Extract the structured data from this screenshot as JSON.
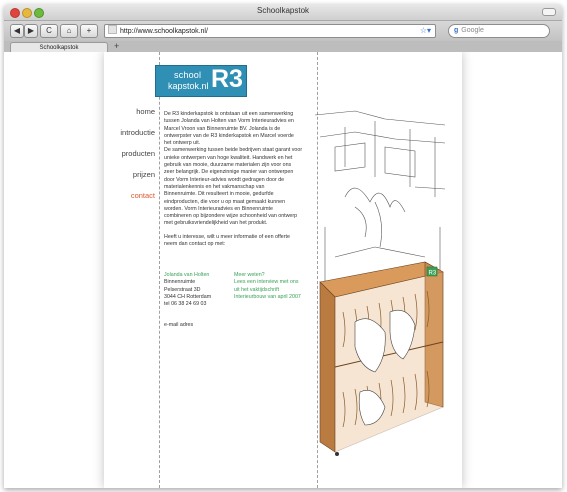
{
  "window": {
    "title": "Schoolkapstok"
  },
  "toolbar": {
    "back": "◀",
    "forward": "▶",
    "reload": "C",
    "home": "⌂",
    "add": "+",
    "url": "http://www.schoolkapstok.nl/",
    "search_placeholder": "Google"
  },
  "tabs": [
    {
      "label": "Schoolkapstok"
    }
  ],
  "logo": {
    "word1": "school",
    "word2": "kapstok.nl",
    "mark": "R3"
  },
  "nav": [
    {
      "label": "home"
    },
    {
      "label": "introductie"
    },
    {
      "label": "producten"
    },
    {
      "label": "prijzen"
    },
    {
      "label": "contact"
    }
  ],
  "content": {
    "lines": [
      "De R3 kinderkapstok is ontstaan uit een samenwerking",
      "tussen Jolanda van Holten van Vorm Interieuradvies en",
      "Marcel Vroon van Binnenruimte BV. Jolanda is de",
      "ontwerpster van de R3 kinderkapstok en Marcel voerde",
      "het ontwerp uit.",
      "De samenwerking tussen beide bedrijven staat garant voor",
      "unieke ontwerpen van hoge kwaliteit. Handwerk en het",
      "gebruik van mooie, duurzame materialen zijn voor ons",
      "zeer belangrijk. De eigenzinnige manier van ontwerpen",
      "door Vorm Interieur-advies wordt gedragen door de",
      "materialenkennis en het vakmanschap van",
      "Binnenruimte. Dit resulteert in mooie, gedurfde",
      "eindproducten, die voor u op maat gemaakt kunnen",
      "worden. Vorm Interieuradvies en Binnenruimte",
      "combineren op bijzondere wijze schoonheid van ontwerp",
      "met gebruiksvriendelijkheid van het produkt."
    ],
    "closing": [
      "Heeft u interesse, wilt u meer informatie of een offerte",
      "neem dan contact op met:"
    ]
  },
  "contact": {
    "name": "Jolanda van Holten",
    "company": "Binnenruimte",
    "street": "Pelserstraat 3D",
    "city": "3044 CH Rotterdam",
    "phone": "tel 06 38 24 69 03",
    "meer_title": "Meer weten?",
    "link1": "Lees een interview met ons",
    "link2": "uit het vaktijdschrift",
    "link3": "Interieurbouw van april 2007",
    "email": "e-mail adres"
  },
  "colors": {
    "accent": "#e2562c",
    "link": "#3aa157",
    "logo": "#2f8fb5",
    "wood": "#c98a4e"
  }
}
